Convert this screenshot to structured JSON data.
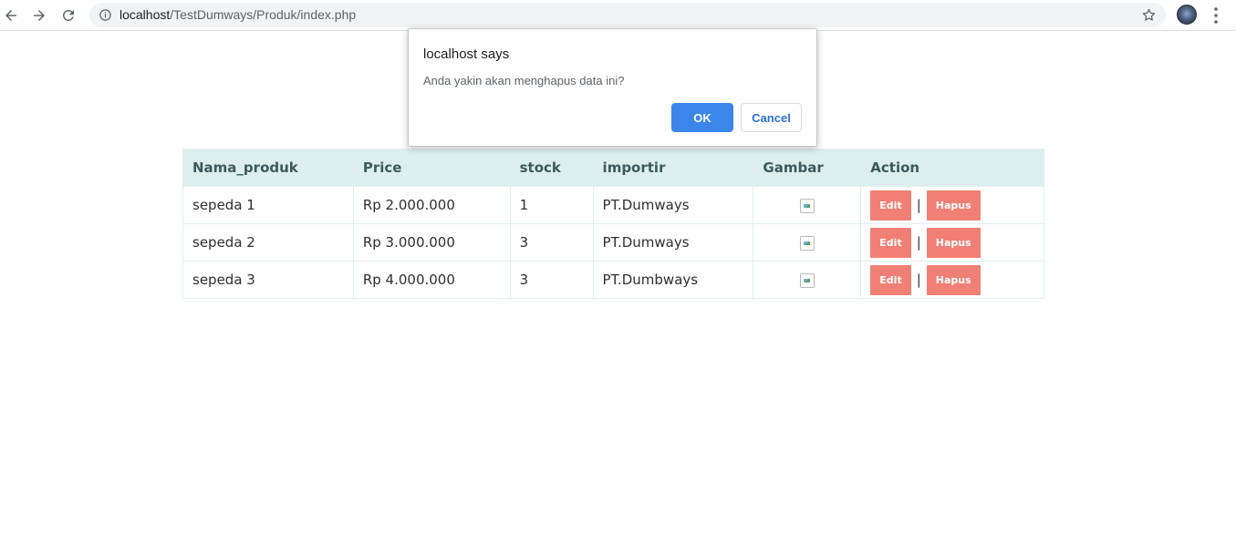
{
  "browser": {
    "url_host": "localhost",
    "url_path": "/TestDumways/Produk/index.php",
    "icons": [
      "back-arrow-icon",
      "forward-arrow-icon",
      "reload-icon",
      "info-icon",
      "star-icon",
      "avatar",
      "kebab-menu-icon"
    ]
  },
  "table": {
    "headers": [
      "Nama_produk",
      "Price",
      "stock",
      "importir",
      "Gambar",
      "Action"
    ],
    "rows": [
      {
        "nama": "sepeda 1",
        "price": "Rp 2.000.000",
        "stock": "1",
        "importir": "PT.Dumways",
        "edit": "Edit",
        "sep": "|",
        "hapus": "Hapus"
      },
      {
        "nama": "sepeda 2",
        "price": "Rp 3.000.000",
        "stock": "3",
        "importir": "PT.Dumways",
        "edit": "Edit",
        "sep": "|",
        "hapus": "Hapus"
      },
      {
        "nama": "sepeda 3",
        "price": "Rp 4.000.000",
        "stock": "3",
        "importir": "PT.Dumbways",
        "edit": "Edit",
        "sep": "|",
        "hapus": "Hapus"
      }
    ],
    "colors": {
      "header_bg": "#ddeeef",
      "button_bg": "#f08075"
    }
  },
  "dialog": {
    "title": "localhost says",
    "message": "Anda yakin akan menghapus data ini?",
    "ok_label": "OK",
    "cancel_label": "Cancel",
    "colors": {
      "ok_bg": "#3b86e8"
    }
  }
}
